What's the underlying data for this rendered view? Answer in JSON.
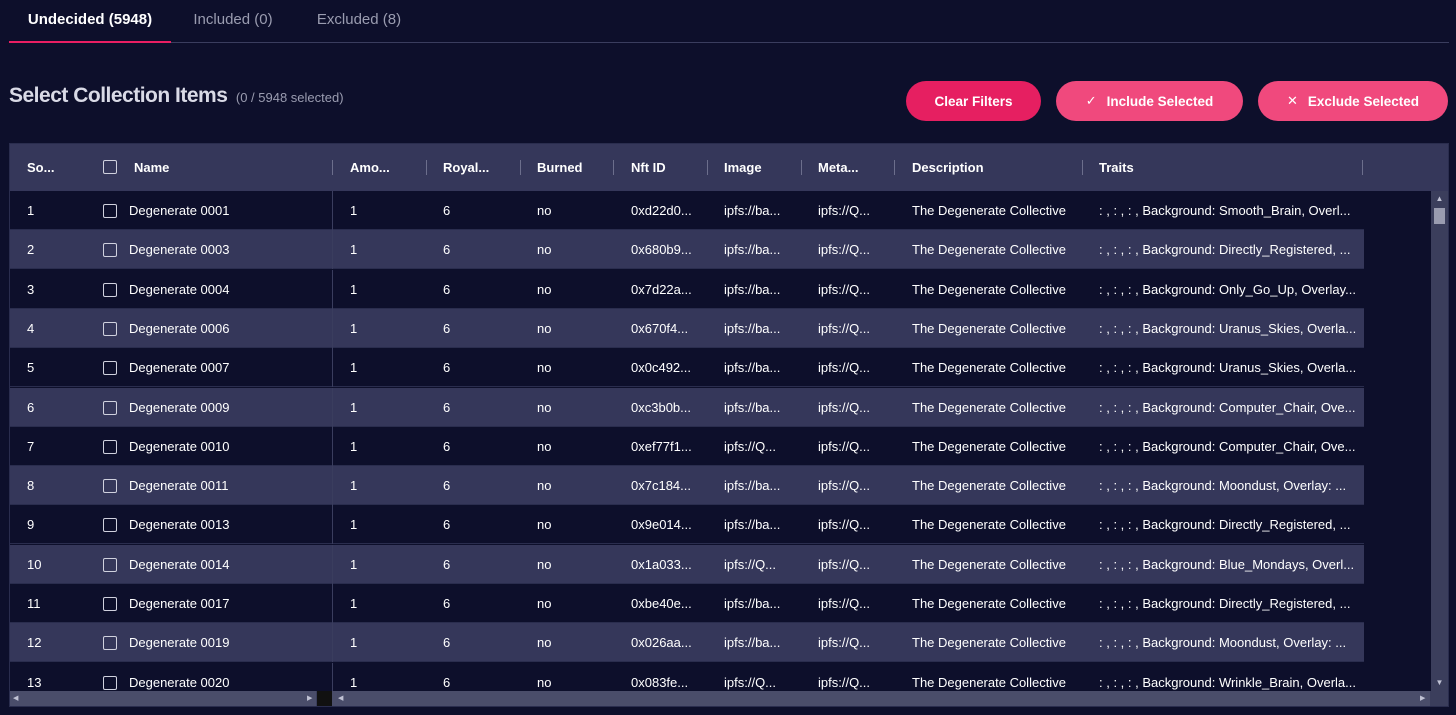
{
  "tabs": [
    {
      "label": "Undecided (5948)",
      "active": true
    },
    {
      "label": "Included (0)",
      "active": false
    },
    {
      "label": "Excluded (8)",
      "active": false
    }
  ],
  "page_title": "Select Collection Items",
  "selection_count": "(0 / 5948 selected)",
  "buttons": {
    "clear_filters": "Clear Filters",
    "include_selected": "Include Selected",
    "exclude_selected": "Exclude Selected"
  },
  "icons": {
    "include": "check-icon",
    "exclude": "close-icon"
  },
  "colors": {
    "accent": "#e91e63",
    "button_pink": "#f0497d",
    "background": "#0d0f2b",
    "row_alt": "#35375a"
  },
  "table": {
    "columns": [
      "So...",
      "Name",
      "Amo...",
      "Royal...",
      "Burned",
      "Nft ID",
      "Image",
      "Meta...",
      "Description",
      "Traits"
    ],
    "rows": [
      {
        "sort": "1",
        "name": "Degenerate 0001",
        "amount": "1",
        "royalty": "6",
        "burned": "no",
        "nft_id": "0xd22d0...",
        "image": "ipfs://ba...",
        "metadata": "ipfs://Q...",
        "description": "The Degenerate Collective",
        "traits": ": , : , : , Background: Smooth_Brain, Overl..."
      },
      {
        "sort": "2",
        "name": "Degenerate 0003",
        "amount": "1",
        "royalty": "6",
        "burned": "no",
        "nft_id": "0x680b9...",
        "image": "ipfs://ba...",
        "metadata": "ipfs://Q...",
        "description": "The Degenerate Collective",
        "traits": ": , : , : , Background: Directly_Registered, ..."
      },
      {
        "sort": "3",
        "name": "Degenerate 0004",
        "amount": "1",
        "royalty": "6",
        "burned": "no",
        "nft_id": "0x7d22a...",
        "image": "ipfs://ba...",
        "metadata": "ipfs://Q...",
        "description": "The Degenerate Collective",
        "traits": ": , : , : , Background: Only_Go_Up, Overlay..."
      },
      {
        "sort": "4",
        "name": "Degenerate 0006",
        "amount": "1",
        "royalty": "6",
        "burned": "no",
        "nft_id": "0x670f4...",
        "image": "ipfs://ba...",
        "metadata": "ipfs://Q...",
        "description": "The Degenerate Collective",
        "traits": ": , : , : , Background: Uranus_Skies, Overla..."
      },
      {
        "sort": "5",
        "name": "Degenerate 0007",
        "amount": "1",
        "royalty": "6",
        "burned": "no",
        "nft_id": "0x0c492...",
        "image": "ipfs://ba...",
        "metadata": "ipfs://Q...",
        "description": "The Degenerate Collective",
        "traits": ": , : , : , Background: Uranus_Skies, Overla..."
      },
      {
        "sort": "6",
        "name": "Degenerate 0009",
        "amount": "1",
        "royalty": "6",
        "burned": "no",
        "nft_id": "0xc3b0b...",
        "image": "ipfs://ba...",
        "metadata": "ipfs://Q...",
        "description": "The Degenerate Collective",
        "traits": ": , : , : , Background: Computer_Chair, Ove..."
      },
      {
        "sort": "7",
        "name": "Degenerate 0010",
        "amount": "1",
        "royalty": "6",
        "burned": "no",
        "nft_id": "0xef77f1...",
        "image": "ipfs://Q...",
        "metadata": "ipfs://Q...",
        "description": "The Degenerate Collective",
        "traits": ": , : , : , Background: Computer_Chair, Ove..."
      },
      {
        "sort": "8",
        "name": "Degenerate 0011",
        "amount": "1",
        "royalty": "6",
        "burned": "no",
        "nft_id": "0x7c184...",
        "image": "ipfs://ba...",
        "metadata": "ipfs://Q...",
        "description": "The Degenerate Collective",
        "traits": ": , : , : , Background: Moondust, Overlay: ..."
      },
      {
        "sort": "9",
        "name": "Degenerate 0013",
        "amount": "1",
        "royalty": "6",
        "burned": "no",
        "nft_id": "0x9e014...",
        "image": "ipfs://ba...",
        "metadata": "ipfs://Q...",
        "description": "The Degenerate Collective",
        "traits": ": , : , : , Background: Directly_Registered, ..."
      },
      {
        "sort": "10",
        "name": "Degenerate 0014",
        "amount": "1",
        "royalty": "6",
        "burned": "no",
        "nft_id": "0x1a033...",
        "image": "ipfs://Q...",
        "metadata": "ipfs://Q...",
        "description": "The Degenerate Collective",
        "traits": ": , : , : , Background: Blue_Mondays, Overl..."
      },
      {
        "sort": "11",
        "name": "Degenerate 0017",
        "amount": "1",
        "royalty": "6",
        "burned": "no",
        "nft_id": "0xbe40e...",
        "image": "ipfs://ba...",
        "metadata": "ipfs://Q...",
        "description": "The Degenerate Collective",
        "traits": ": , : , : , Background: Directly_Registered, ..."
      },
      {
        "sort": "12",
        "name": "Degenerate 0019",
        "amount": "1",
        "royalty": "6",
        "burned": "no",
        "nft_id": "0x026aa...",
        "image": "ipfs://ba...",
        "metadata": "ipfs://Q...",
        "description": "The Degenerate Collective",
        "traits": ": , : , : , Background: Moondust, Overlay: ..."
      },
      {
        "sort": "13",
        "name": "Degenerate 0020",
        "amount": "1",
        "royalty": "6",
        "burned": "no",
        "nft_id": "0x083fe...",
        "image": "ipfs://Q...",
        "metadata": "ipfs://Q...",
        "description": "The Degenerate Collective",
        "traits": ": , : , : , Background: Wrinkle_Brain, Overla..."
      }
    ]
  }
}
